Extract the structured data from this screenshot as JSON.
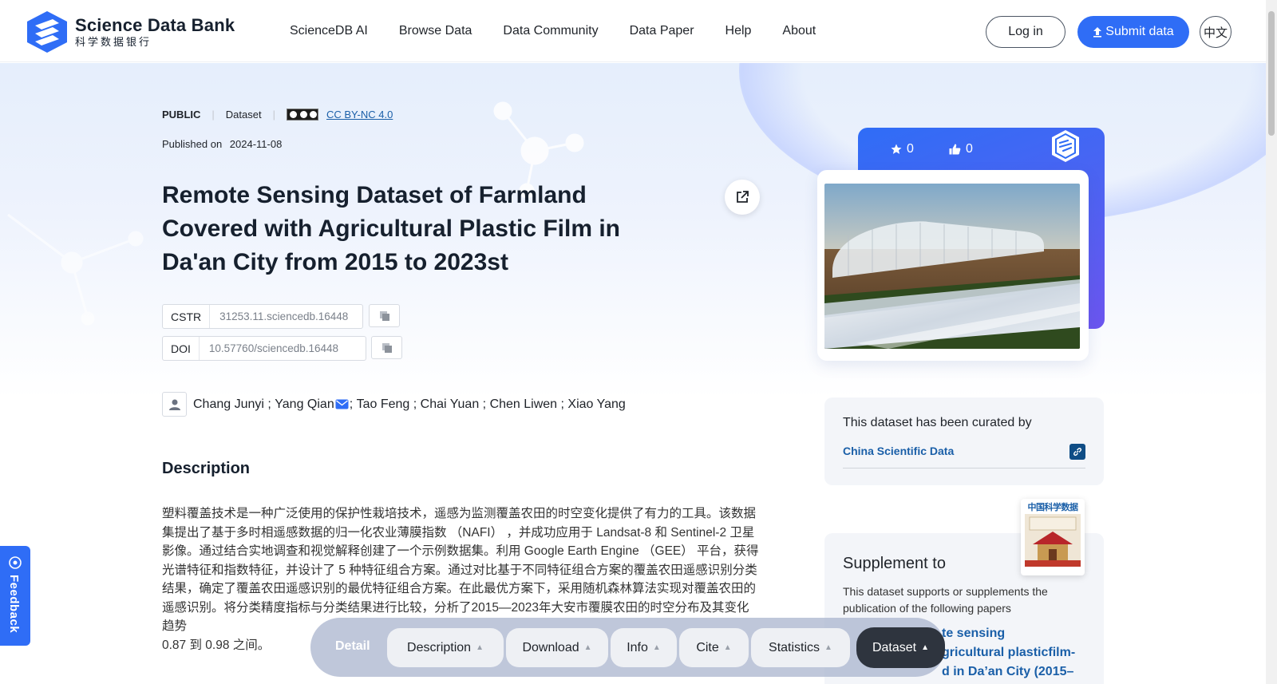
{
  "header": {
    "logo_en": "Science Data Bank",
    "logo_cn": "科学数据银行",
    "nav": [
      "ScienceDB AI",
      "Browse Data",
      "Data Community",
      "Data Paper",
      "Help",
      "About"
    ],
    "login_label": "Log in",
    "submit_label": "Submit data",
    "lang_label": "中文"
  },
  "dataset": {
    "access": "PUBLIC",
    "type": "Dataset",
    "license": "CC BY-NC 4.0",
    "published_label": "Published on",
    "published_date": "2024-11-08",
    "title": "Remote Sensing Dataset of Farmland Covered with Agricultural Plastic Film in Da'an City from 2015 to 2023st",
    "cstr_label": "CSTR",
    "cstr_value": "31253.11.sciencedb.16448",
    "doi_label": "DOI",
    "doi_value": "10.57760/sciencedb.16448",
    "authors": [
      {
        "name": "Chang Junyi",
        "sep": " ; "
      },
      {
        "name": "Yang Qian",
        "sep": "; "
      },
      {
        "name": "Tao Feng",
        "sep": " ; "
      },
      {
        "name": "Chai Yuan",
        "sep": " ; "
      },
      {
        "name": "Chen Liwen",
        "sep": " ; "
      },
      {
        "name": "Xiao Yang",
        "sep": ""
      }
    ]
  },
  "description": {
    "heading": "Description",
    "text": "塑料覆盖技术是一种广泛使用的保护性栽培技术，遥感为监测覆盖农田的时空变化提供了有力的工具。该数据集提出了基于多时相遥感数据的归一化农业薄膜指数 （NAFI） ，并成功应用于 Landsat-8 和 Sentinel-2 卫星影像。通过结合实地调查和视觉解释创建了一个示例数据集。利用 Google Earth Engine （GEE） 平台，获得光谱特征和指数特征，并设计了 5 种特征组合方案。通过对比基于不同特征组合方案的覆盖农田遥感识别分类结果，确定了覆盖农田遥感识别的最优特征组合方案。在此最优方案下，采用随机森林算法实现对覆盖农田的遥感识别。将分类精度指标与分类结果进行比较，分析了2015—2023年大安市覆膜农田的时空分布及其变化趋势",
    "text_tail": "0.87 到 0.98 之间。"
  },
  "card": {
    "stars": "0",
    "likes": "0"
  },
  "curated": {
    "title": "This dataset has been curated by",
    "link": "China Scientific Data"
  },
  "supplement": {
    "title": "Supplement to",
    "subtitle": "This dataset supports or supplements the publication of the following papers",
    "paper_visible": "te sensing\ngricultural plasticfilm-\nd in Da’an City (2015–",
    "journal_cover_title": "中国科学数据"
  },
  "tabbar": {
    "detail": "Detail",
    "tabs": [
      "Description",
      "Download",
      "Info",
      "Cite",
      "Statistics",
      "Dataset"
    ],
    "active": "Dataset"
  },
  "feedback": "Feedback",
  "colors": {
    "primary": "#2f6df6",
    "link": "#1a5fa8",
    "dark": "#2e343e"
  }
}
